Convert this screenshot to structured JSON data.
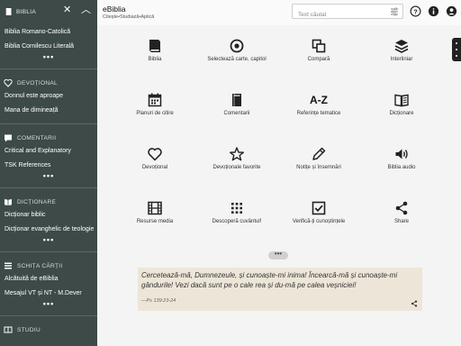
{
  "sidebar": {
    "header": "BIBLIA",
    "collapse_icon": "chevron-up-icon",
    "sections": [
      {
        "icon": "book-icon",
        "title": "BIBLIA",
        "items": [
          "Biblia Romano-Catolică",
          "Biblia Cornilescu Literală"
        ]
      },
      {
        "icon": "heart-icon",
        "title": "DEVOȚIONAL",
        "items": [
          "Donnul este aproape",
          "Mana de dimineață"
        ]
      },
      {
        "icon": "comment-icon",
        "title": "COMENTARII",
        "items": [
          "Critical and Explanatory",
          "TSK References"
        ]
      },
      {
        "icon": "book-open-icon",
        "title": "DICȚIONARE",
        "items": [
          "Dicționar biblic",
          "Dicționar evanghelic de teologie"
        ]
      },
      {
        "icon": "outline-icon",
        "title": "SCHIȚA CĂRȚII",
        "items": [
          "Alcătuită de eBiblia",
          "Mesajul VT și NT - M.Dever"
        ]
      },
      {
        "icon": "study-icon",
        "title": "STUDIU",
        "items": []
      }
    ],
    "more_label": "•••"
  },
  "header": {
    "app_title": "eBiblia",
    "subtitle": "Citește•Studiază•Aplică",
    "search_placeholder": "Text căutat"
  },
  "grid": [
    {
      "icon": "bible-icon",
      "label": "Biblia"
    },
    {
      "icon": "target-icon",
      "label": "Selectează carte, capitol"
    },
    {
      "icon": "compare-icon",
      "label": "Compară"
    },
    {
      "icon": "layers-icon",
      "label": "Interliniar"
    },
    {
      "icon": "calendar-icon",
      "label": "Planuri de citire"
    },
    {
      "icon": "commentary-icon",
      "label": "Comentarii"
    },
    {
      "icon": "a-z-icon",
      "label": "Referințe tematice"
    },
    {
      "icon": "dictionary-icon",
      "label": "Dicționare"
    },
    {
      "icon": "heart-outline-icon",
      "label": "Devoțional"
    },
    {
      "icon": "star-icon",
      "label": "Devoționale favorite"
    },
    {
      "icon": "pencil-icon",
      "label": "Notițe și însemnări"
    },
    {
      "icon": "speaker-icon",
      "label": "Biblia audio"
    },
    {
      "icon": "film-icon",
      "label": "Resurse media"
    },
    {
      "icon": "grid-dots-icon",
      "label": "Descoperă cuvântul!"
    },
    {
      "icon": "checkbox-icon",
      "label": "Verifică-ți cunoștințele"
    },
    {
      "icon": "share-icon",
      "label": "Share"
    }
  ],
  "az_text": "A-Z",
  "pager_label": "•••",
  "verse": {
    "text": "Cercetează-mă, Dumnezeule, și cunoaște-mi inima! Încearcă-mă și cunoaște-mi gândurile! Vezi dacă sunt pe o cale rea și du-mă pe calea veșniciei!",
    "reference": "—Ps 139:23-24"
  }
}
